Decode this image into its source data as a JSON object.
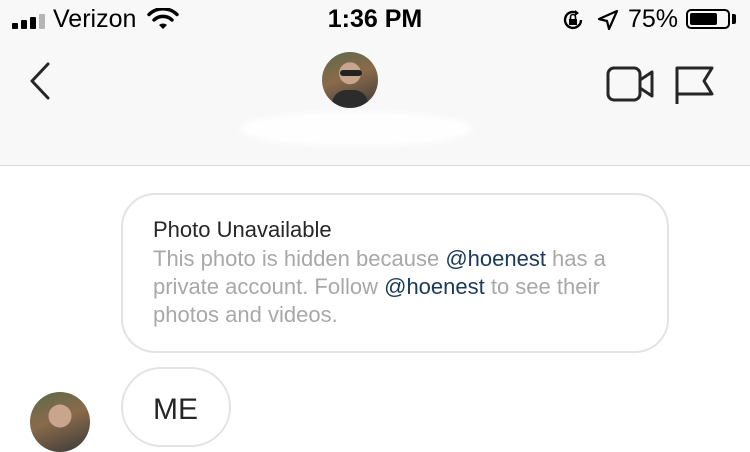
{
  "status_bar": {
    "carrier": "Verizon",
    "time": "1:36 PM",
    "battery_percent": "75%",
    "battery_level": 0.75,
    "signal_bars_filled": 3,
    "signal_bars_total": 4
  },
  "header": {
    "back_icon": "chevron-left-icon",
    "video_icon": "video-camera-icon",
    "flag_icon": "flag-icon"
  },
  "messages": {
    "unavailable": {
      "title": "Photo Unavailable",
      "text_1": "This photo is hidden because ",
      "mention_1": "@hoenest",
      "text_2": " has a private account. Follow ",
      "mention_2": "@hoenest",
      "text_3": " to see their photos and videos."
    },
    "reply": {
      "text": "ME"
    }
  },
  "colors": {
    "header_bg": "#f8f8f8",
    "mention": "#1a3a5a",
    "muted_text": "#a8a8a8",
    "bubble_border": "#e3e3e3"
  }
}
